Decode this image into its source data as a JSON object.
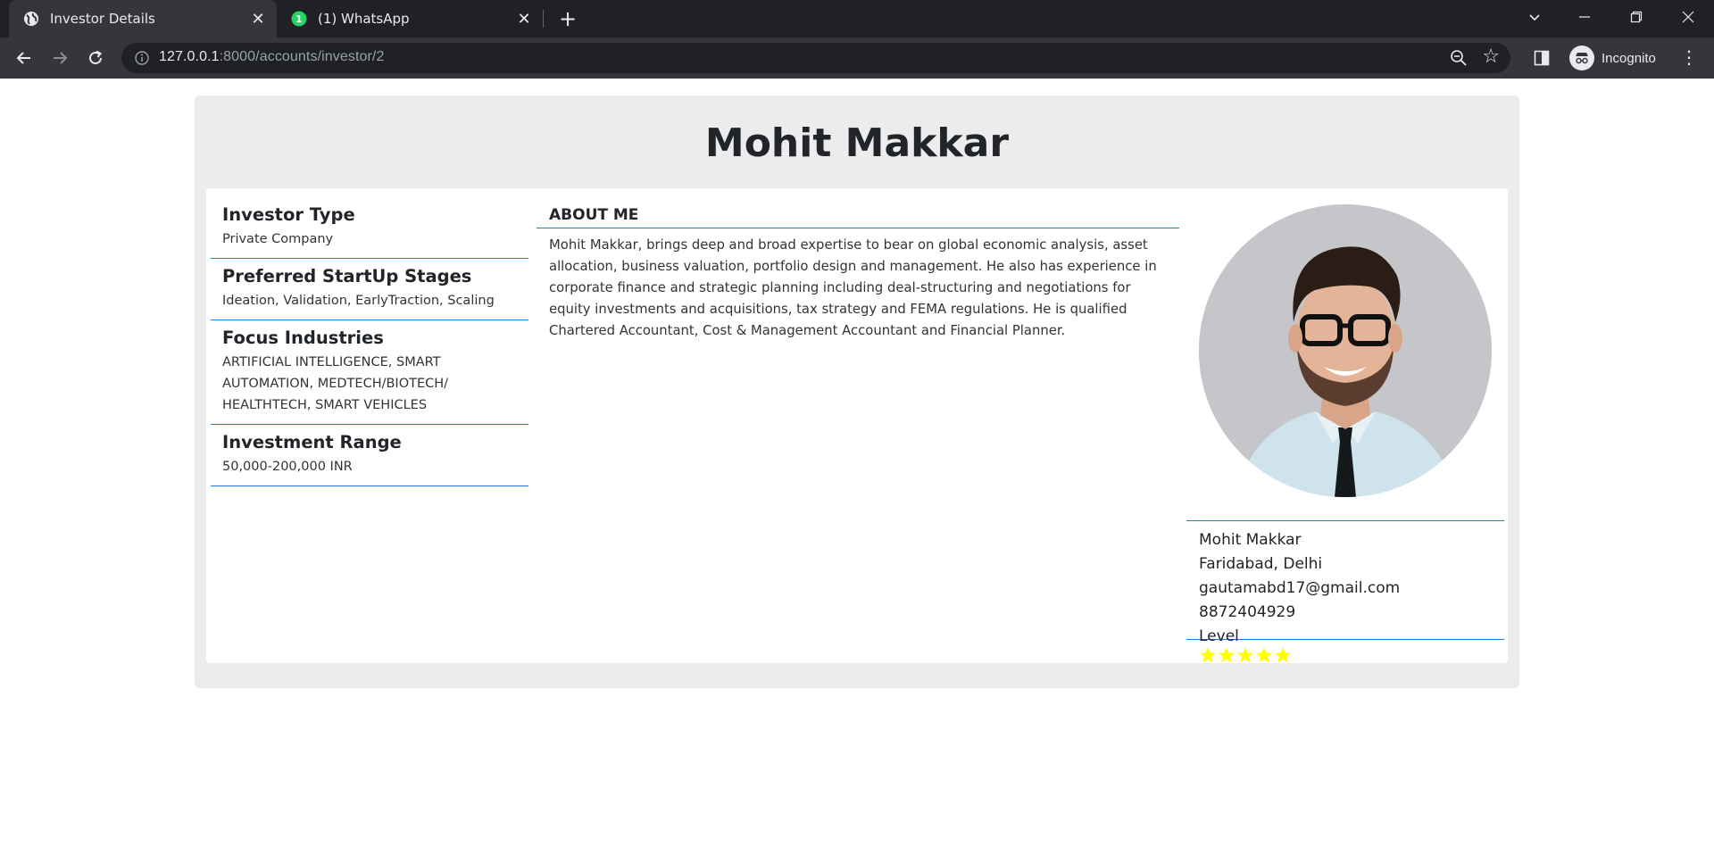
{
  "browser": {
    "tabs": [
      {
        "title": "Investor Details",
        "active": true
      },
      {
        "title": "(1) WhatsApp",
        "active": false
      }
    ],
    "url_host": "127.0.0.1",
    "url_rest": ":8000/accounts/investor/2",
    "profile_label": "Incognito"
  },
  "page": {
    "name": "Mohit Makkar",
    "details": [
      {
        "label": "Investor Type",
        "value": "Private Company"
      },
      {
        "label": "Preferred StartUp Stages",
        "value": "Ideation, Validation, EarlyTraction, Scaling"
      },
      {
        "label": "Focus Industries",
        "value": "ARTIFICIAL INTELLIGENCE, SMART AUTOMATION, MEDTECH/BIOTECH/ HEALTHTECH, SMART VEHICLES"
      },
      {
        "label": "Investment Range",
        "value": "50,000-200,000 INR"
      }
    ],
    "about": {
      "heading": "ABOUT ME",
      "text": "Mohit Makkar, brings deep and broad expertise to bear on global economic analysis, asset allocation, business valuation, portfolio design and management. He also has experience in corporate finance and strategic planning including deal-structuring and negotiations for equity investments and acquisitions, tax strategy and FEMA regulations. He is qualified Chartered Accountant, Cost & Management Accountant and Financial Planner."
    },
    "profile": {
      "name": "Mohit Makkar",
      "location": "Faridabad, Delhi",
      "contact": "gautamabd17@gmail.com 8872404929",
      "level_label": "Level",
      "level_stars": 5,
      "star_color": "#ffff00"
    }
  },
  "colors": {
    "accent_rule": "#1e7bdc",
    "card_bg": "#ececec",
    "chrome_dark": "#202124",
    "chrome_toolbar": "#35363a",
    "whatsapp_green": "#25d366"
  }
}
